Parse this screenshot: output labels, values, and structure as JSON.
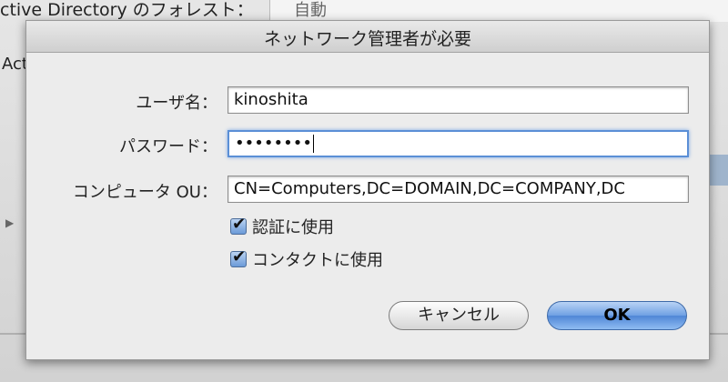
{
  "background": {
    "top_label": "ctive Directory のフォレスト：",
    "top_field_value": "自動",
    "side_label": "Act"
  },
  "dialog": {
    "title": "ネットワーク管理者が必要",
    "username_label": "ユーザ名：",
    "username_value": "kinoshita",
    "password_label": "パスワード：",
    "password_value": "••••••••",
    "ou_label": "コンピュータ OU：",
    "ou_value": "CN=Computers,DC=DOMAIN,DC=COMPANY,DC",
    "checkboxes": [
      {
        "label": "認証に使用",
        "checked": true
      },
      {
        "label": "コンタクトに使用",
        "checked": true
      }
    ],
    "cancel_label": "キャンセル",
    "ok_label": "OK"
  },
  "colors": {
    "accent": "#5b8fd6",
    "ok_button": "#4f86d6"
  }
}
